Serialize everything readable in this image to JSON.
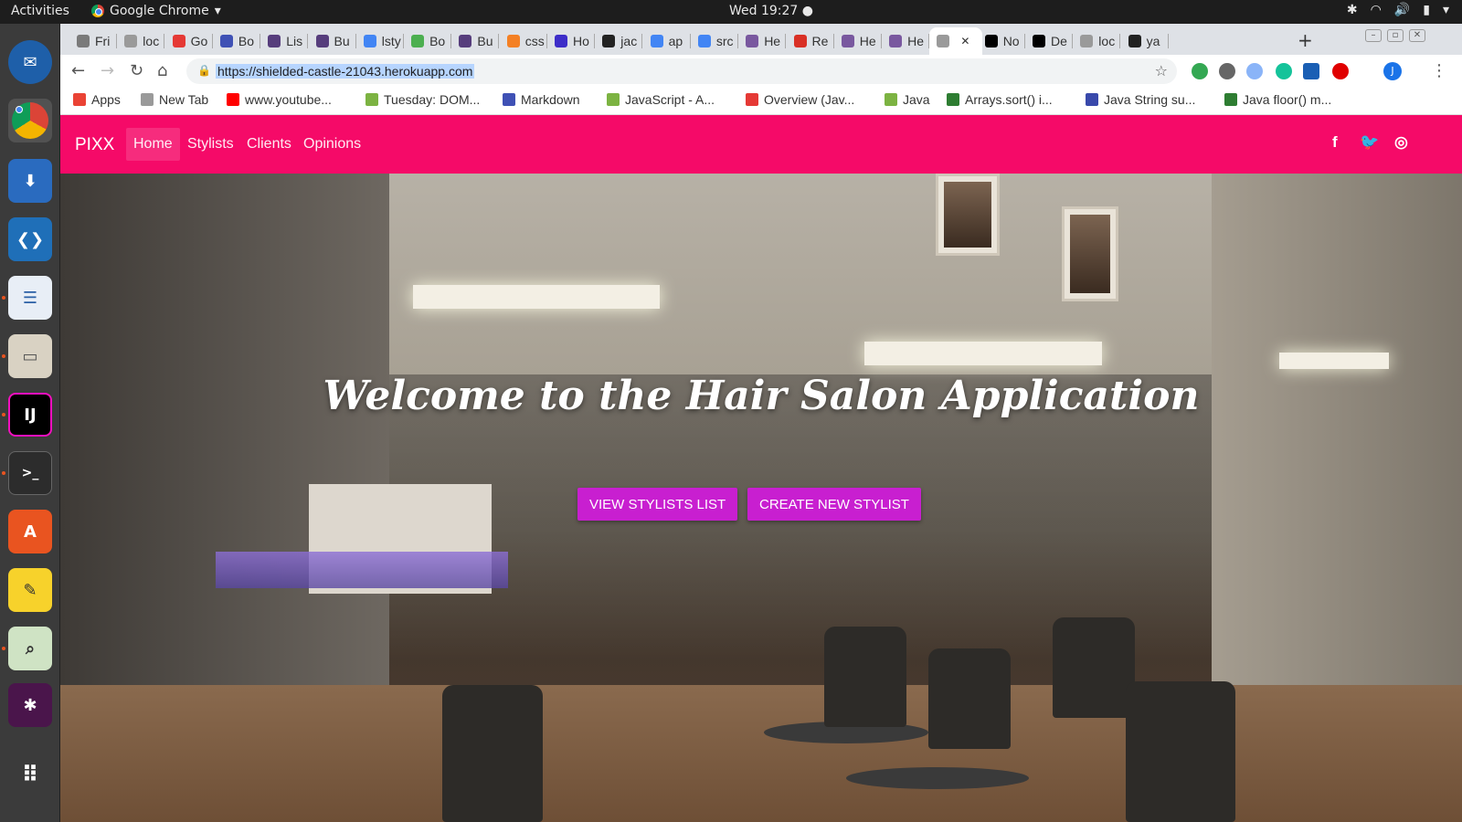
{
  "system": {
    "activities": "Activities",
    "app_name": "Google Chrome",
    "clock": "Wed 19:27"
  },
  "tabs": [
    {
      "label": "Fri",
      "fav_color": "#7a7a7a"
    },
    {
      "label": "loc",
      "fav_color": "#9a9a9a"
    },
    {
      "label": "Go",
      "fav_color": "#e53935"
    },
    {
      "label": "Bo",
      "fav_color": "#3f51b5"
    },
    {
      "label": "Lis",
      "fav_color": "#563d7c"
    },
    {
      "label": "Bu",
      "fav_color": "#563d7c"
    },
    {
      "label": "lsty",
      "fav_color": "#4285f4"
    },
    {
      "label": "Bo",
      "fav_color": "#4caf50"
    },
    {
      "label": "Bu",
      "fav_color": "#563d7c"
    },
    {
      "label": "css",
      "fav_color": "#f48024"
    },
    {
      "label": "Ho",
      "fav_color": "#3d2dc8"
    },
    {
      "label": "jac",
      "fav_color": "#222222"
    },
    {
      "label": "ap",
      "fav_color": "#4285f4"
    },
    {
      "label": "src",
      "fav_color": "#4285f4"
    },
    {
      "label": "He",
      "fav_color": "#79589f"
    },
    {
      "label": "Re",
      "fav_color": "#d93025"
    },
    {
      "label": "He",
      "fav_color": "#79589f"
    },
    {
      "label": "He",
      "fav_color": "#79589f"
    },
    {
      "label": "",
      "fav_color": "#9a9a9a",
      "active": true
    },
    {
      "label": "No",
      "fav_color": "#000000"
    },
    {
      "label": "De",
      "fav_color": "#000000"
    },
    {
      "label": "loc",
      "fav_color": "#9a9a9a"
    },
    {
      "label": "ya",
      "fav_color": "#222222"
    }
  ],
  "toolbar": {
    "url": "https://shielded-castle-21043.herokuapp.com",
    "profile_initial": "J"
  },
  "bookmarks": [
    {
      "label": "Apps",
      "color": "#ea4335"
    },
    {
      "label": "New Tab",
      "color": "#9a9a9a"
    },
    {
      "label": "www.youtube...",
      "color": "#ff0000"
    },
    {
      "label": "Tuesday: DOM...",
      "color": "#7cb342"
    },
    {
      "label": "Markdown",
      "color": "#3f51b5"
    },
    {
      "label": "JavaScript - A...",
      "color": "#7cb342"
    },
    {
      "label": "Overview (Jav...",
      "color": "#e53935"
    },
    {
      "label": "Java",
      "color": "#7cb342"
    },
    {
      "label": "Arrays.sort() i...",
      "color": "#2e7d32"
    },
    {
      "label": "Java String su...",
      "color": "#3949ab"
    },
    {
      "label": "Java floor() m...",
      "color": "#2e7d32"
    }
  ],
  "site": {
    "brand": "PIXX",
    "nav": [
      "Home",
      "Stylists",
      "Clients",
      "Opinions"
    ],
    "hero_title": "Welcome to the Hair Salon Application",
    "buttons": [
      "VIEW STYLISTS LIST",
      "CREATE NEW STYLIST"
    ],
    "accent": "#f50a68",
    "button_color": "#c81fd0"
  }
}
